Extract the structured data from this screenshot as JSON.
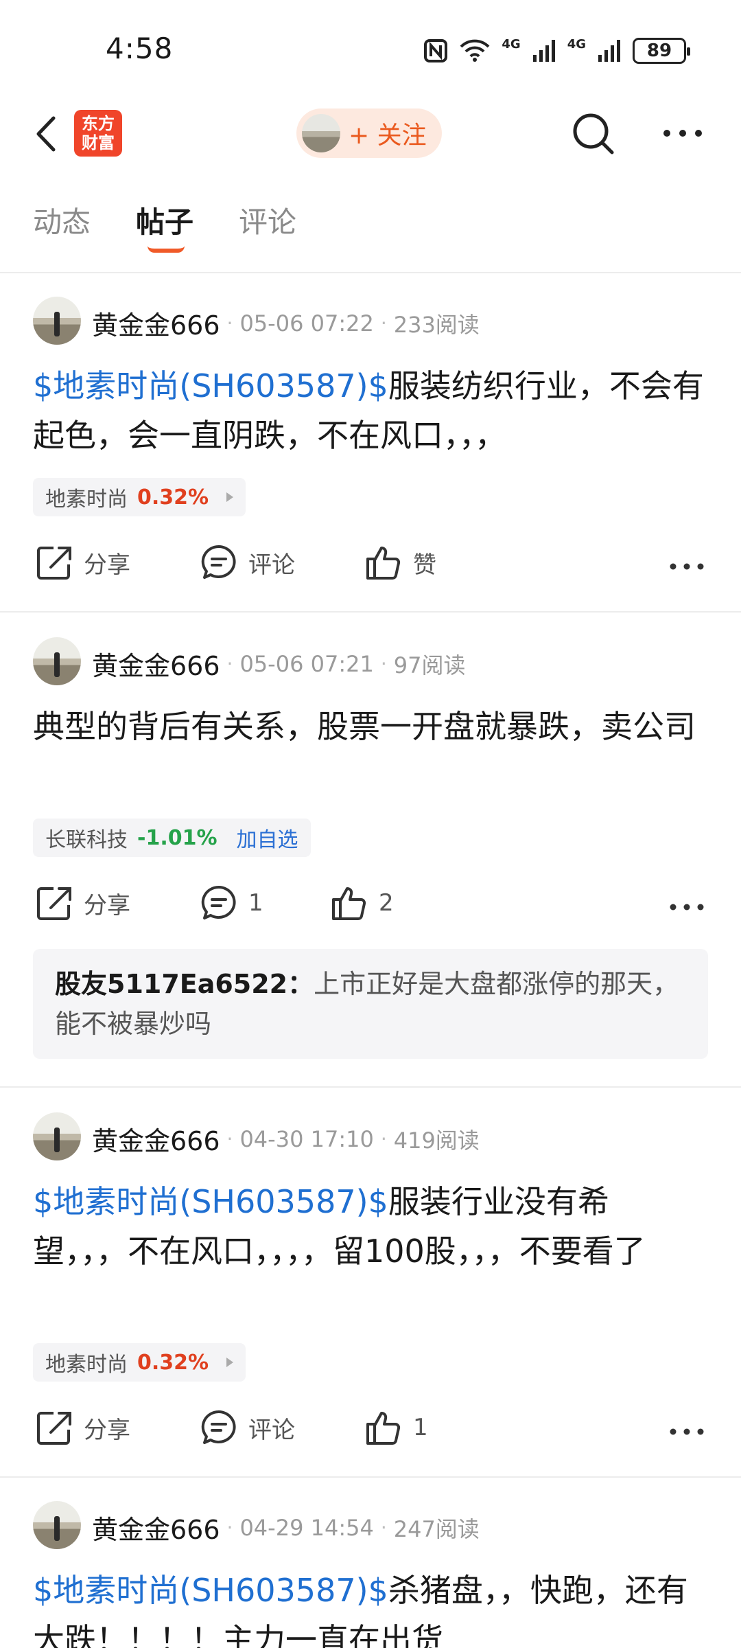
{
  "status_bar": {
    "time": "4:58",
    "battery": "89",
    "signal1": "4G",
    "signal2": "4G"
  },
  "header": {
    "logo_line1": "东方",
    "logo_line2": "财富",
    "follow_label": "+ 关注"
  },
  "tabs": [
    {
      "label": "动态"
    },
    {
      "label": "帖子"
    },
    {
      "label": "评论"
    }
  ],
  "posts": [
    {
      "author": "黄金金666",
      "time": "05-06 07:22",
      "reads": "233阅读",
      "tag": "$地素时尚(SH603587)$",
      "text": "服装纺织行业，不会有起色，会一直阴跌，不在风口，，，",
      "stock_name": "地素时尚",
      "stock_change": "0.32%",
      "share_label": "分享",
      "comment_label": "评论",
      "like_label": "赞"
    },
    {
      "author": "黄金金666",
      "time": "05-06 07:21",
      "reads": "97阅读",
      "tag": "",
      "text": "典型的背后有关系，股票一开盘就暴跌，卖公司",
      "stock_name": "长联科技",
      "stock_change": "-1.01%",
      "stock_action": "加自选",
      "share_label": "分享",
      "comment_label": "1",
      "like_label": "2",
      "reply_user": "股友5117Ea6522：",
      "reply_text": "上市正好是大盘都涨停的那天，能不被暴炒吗"
    },
    {
      "author": "黄金金666",
      "time": "04-30 17:10",
      "reads": "419阅读",
      "tag": "$地素时尚(SH603587)$",
      "text": "服装行业没有希望，，，不在风口，，，，留100股，，，不要看了",
      "stock_name": "地素时尚",
      "stock_change": "0.32%",
      "share_label": "分享",
      "comment_label": "评论",
      "like_label": "1"
    },
    {
      "author": "黄金金666",
      "time": "04-29 14:54",
      "reads": "247阅读",
      "tag": "$地素时尚(SH603587)$",
      "text": "杀猪盘，，快跑，还有大跌！！！！主力一直在出货"
    }
  ]
}
